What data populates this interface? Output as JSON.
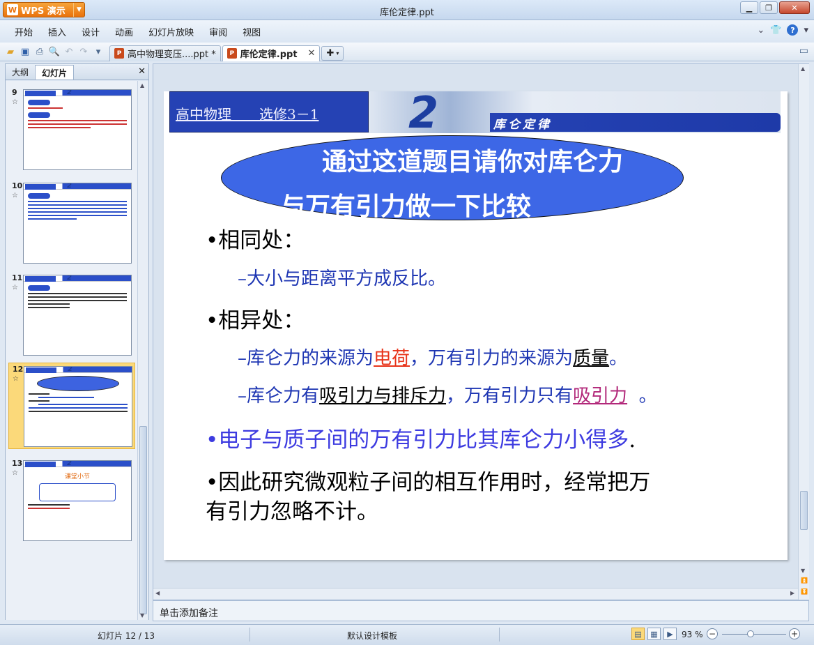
{
  "window": {
    "app_name": "WPS 演示",
    "title": "库伦定律.ppt"
  },
  "menu": [
    "开始",
    "插入",
    "设计",
    "动画",
    "幻灯片放映",
    "审阅",
    "视图"
  ],
  "doc_tabs": [
    {
      "label": "高中物理变压....ppt *"
    },
    {
      "label": "库伦定律.ppt"
    }
  ],
  "left_pane": {
    "tabs": [
      "大纲",
      "幻灯片"
    ],
    "thumbnails": [
      {
        "number": "9"
      },
      {
        "number": "10"
      },
      {
        "number": "11"
      },
      {
        "number": "12"
      },
      {
        "number": "13",
        "mini_title": "课堂小节"
      }
    ]
  },
  "slide": {
    "header_left": "高中物理　　选修3－1",
    "chapter_number": "2",
    "chapter_title": "库仑定律",
    "question_line1": "通过这道题目请你对库仑力",
    "question_line2": "与万有引力做一下比较",
    "same_heading": "•相同处：",
    "same_item": "–大小与距离平方成反比。",
    "diff_heading": "•相异处：",
    "diff_item1": {
      "prefix": "–库仑力的来源为",
      "red": "电荷",
      "middle": "，万有引力的来源为",
      "underlined": "质量",
      "suffix": "。"
    },
    "diff_item2": {
      "prefix": "–库仑力有",
      "underlined": "吸引力与排斥力",
      "middle": "，万有引力只有",
      "purple": "吸引力",
      "suffix": "  。"
    },
    "point3": "•电子与质子间的万有引力比其库仑力小得多",
    "point3_end": ".",
    "point4_line1": "•因此研究微观粒子间的相互作用时，经常把万",
    "point4_line2": "有引力忽略不计。"
  },
  "notes_placeholder": "单击添加备注",
  "status": {
    "slide_counter": "幻灯片 12 / 13",
    "template": "默认设计模板",
    "zoom": "93 %"
  },
  "colors": {
    "accent_blue": "#2542b4",
    "ellipse_blue": "#3d67e6",
    "red_text": "#e8341a",
    "purple_text": "#b2287a",
    "wps_orange": "#e9720d"
  }
}
